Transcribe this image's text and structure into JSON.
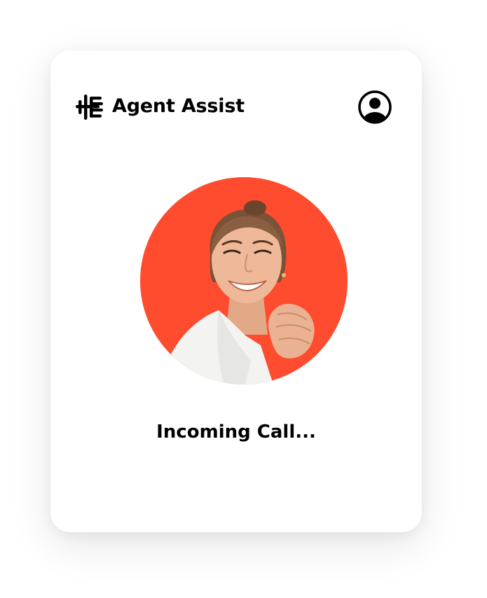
{
  "header": {
    "logo_icon": "soundwave-logo-icon",
    "title": "Agent Assist",
    "profile_icon": "user-circle-icon"
  },
  "call": {
    "avatar_icon": "caller-photo",
    "status": "Incoming Call..."
  },
  "colors": {
    "card_background": "#ffffff",
    "avatar_background": "#ff4b2e",
    "text": "#000000"
  }
}
